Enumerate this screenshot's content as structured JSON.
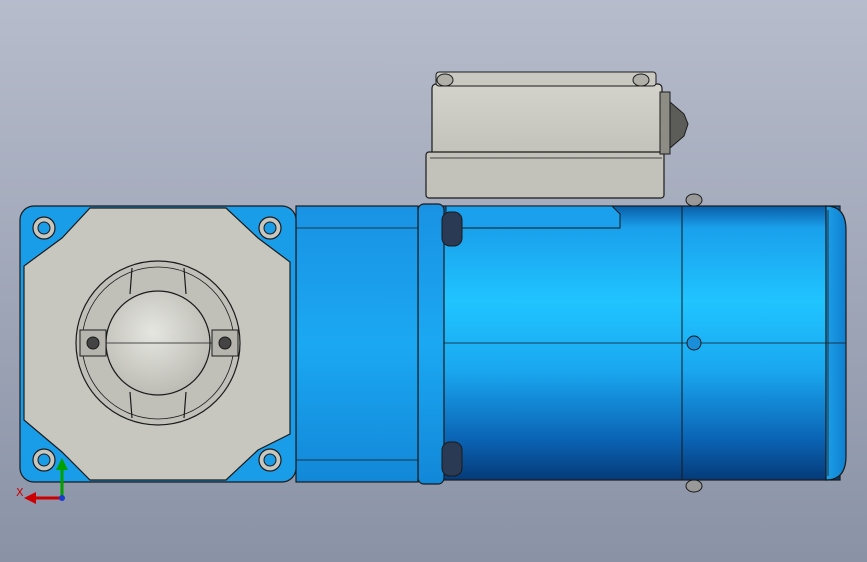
{
  "viewport": {
    "background_top": "#b4bac8",
    "background_bottom": "#8b93a7"
  },
  "model": {
    "motor_color": "#1aa7f0",
    "gearbox_face_color": "#c7c7c0",
    "terminal_box_color": "#c6c6bf",
    "outline_color": "#1a1a1a"
  },
  "triad": {
    "x_label": "X",
    "x_color": "#cc0000",
    "y_color": "#00a000"
  }
}
